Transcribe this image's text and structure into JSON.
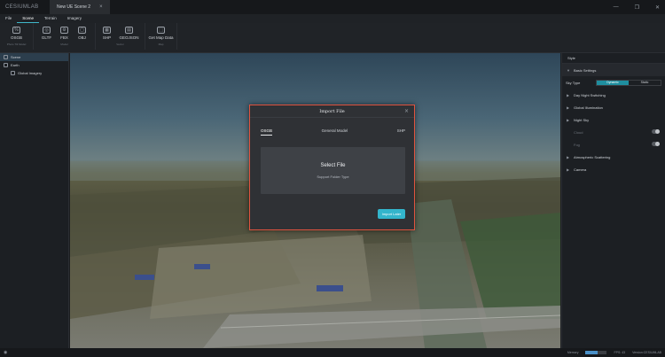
{
  "app": {
    "logo": "CESIUMLAB",
    "doc_tab": "New UE Scene 2",
    "doc_close": "×"
  },
  "window_controls": {
    "minimize": "—",
    "maximize": "❐",
    "close": "✕"
  },
  "menu": [
    {
      "label": "File"
    },
    {
      "label": "Scene"
    },
    {
      "label": "Terrain"
    },
    {
      "label": "Imagery"
    }
  ],
  "toolbar": {
    "groups": [
      {
        "label": "Photo Tilt Model",
        "buttons": [
          {
            "label": "OSGB",
            "icon": "%"
          }
        ]
      },
      {
        "label": "Model",
        "buttons": [
          {
            "label": "GLTF",
            "icon": "◎"
          },
          {
            "label": "FBX",
            "icon": "⚙"
          },
          {
            "label": "OBJ",
            "icon": "▢"
          }
        ]
      },
      {
        "label": "Vector",
        "buttons": [
          {
            "label": "SHP",
            "icon": "▦"
          },
          {
            "label": "GEOJSON",
            "icon": "▤"
          }
        ]
      },
      {
        "label": "Map",
        "buttons": [
          {
            "label": "Get Map Data",
            "icon": "⬚"
          }
        ]
      }
    ]
  },
  "tree": [
    {
      "label": "Scene",
      "selected": true,
      "level": 1
    },
    {
      "label": "Earth",
      "selected": false,
      "level": 1
    },
    {
      "label": "Global Imagery",
      "selected": false,
      "level": 2
    }
  ],
  "dialog": {
    "title": "Import File",
    "close": "×",
    "tabs": [
      "OSGB",
      "General Model",
      "SHP"
    ],
    "active_tab": "OSGB",
    "dropzone_title": "Select File",
    "dropzone_sub": "Support Folder Type",
    "button": "Import Later"
  },
  "right_panel": {
    "title": "Style",
    "basic_settings": "Basic Settings",
    "sky_type_label": "Sky Type",
    "sky_options": [
      "Dynamic",
      "Static"
    ],
    "sky_selected": "Dynamic",
    "sections": [
      "Day Night Switching",
      "Global Illumination",
      "Night Sky"
    ],
    "toggles": [
      "Cloud",
      "Fog"
    ],
    "sections_after": [
      "Atmospheric Scattering",
      "Camera"
    ]
  },
  "status": {
    "memory_label": "Memory",
    "memory_fraction": 0.55,
    "fps": "FPS: 43",
    "version": "Version:CESIUMLAB"
  },
  "colors": {
    "accent": "#33b5cc",
    "dialog_border": "#e0533f",
    "selected_tree": "#2c3e4d"
  }
}
